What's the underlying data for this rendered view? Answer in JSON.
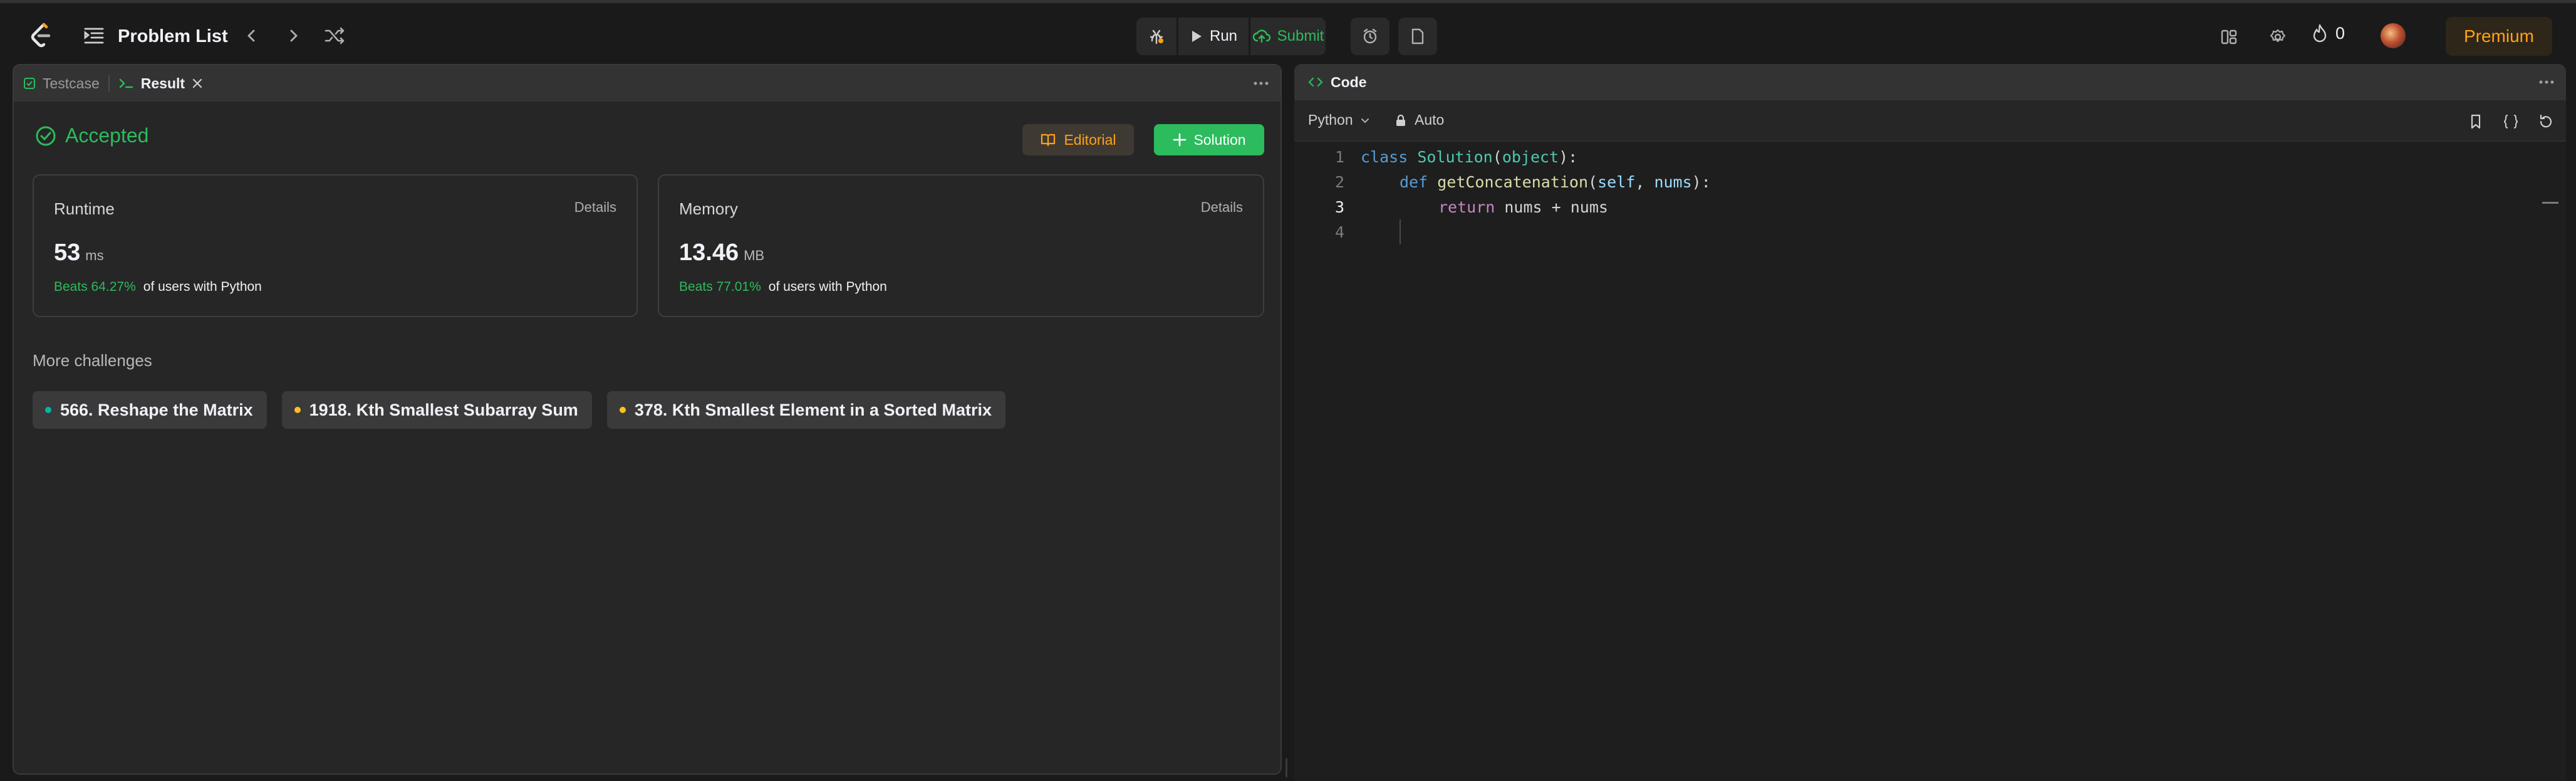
{
  "header": {
    "problem_list_label": "Problem List",
    "run_label": "Run",
    "submit_label": "Submit",
    "streak_count": "0",
    "premium_label": "Premium"
  },
  "colors": {
    "accent_green": "#2cbb5d",
    "accent_orange": "#ffa116",
    "background": "#1a1a1a",
    "panel": "#262626"
  },
  "left_panel": {
    "tabs": [
      {
        "label": "Testcase",
        "icon": "checkbox-icon",
        "active": false
      },
      {
        "label": "Result",
        "icon": "terminal-icon",
        "active": true
      }
    ],
    "status": "Accepted",
    "editorial_label": "Editorial",
    "solution_label": "Solution",
    "runtime": {
      "title": "Runtime",
      "details_label": "Details",
      "value": "53",
      "unit": "ms",
      "beats": "Beats 64.27%",
      "beats_suffix": "of users with Python"
    },
    "memory": {
      "title": "Memory",
      "details_label": "Details",
      "value": "13.46",
      "unit": "MB",
      "beats": "Beats 77.01%",
      "beats_suffix": "of users with Python"
    },
    "more_challenges_title": "More challenges",
    "challenges": [
      {
        "label": "566. Reshape the Matrix",
        "difficulty_color": "#00b8a3"
      },
      {
        "label": "1918. Kth Smallest Subarray Sum",
        "difficulty_color": "#ffc01e"
      },
      {
        "label": "378. Kth Smallest Element in a Sorted Matrix",
        "difficulty_color": "#ffc01e"
      }
    ]
  },
  "code_panel": {
    "title": "Code",
    "language": "Python",
    "mode": "Auto",
    "line_numbers": [
      "1",
      "2",
      "3",
      "4"
    ],
    "current_line": 3,
    "lines": {
      "l1": {
        "kw": "class",
        "cls": "Solution",
        "open": "(",
        "base": "object",
        "close": "):"
      },
      "l2": {
        "kw": "def",
        "fn": "getConcatenation",
        "open": "(",
        "p1": "self",
        "sep": ", ",
        "p2": "nums",
        "close": "):"
      },
      "l3": {
        "kw": "return",
        "expr": "nums + nums"
      }
    }
  }
}
